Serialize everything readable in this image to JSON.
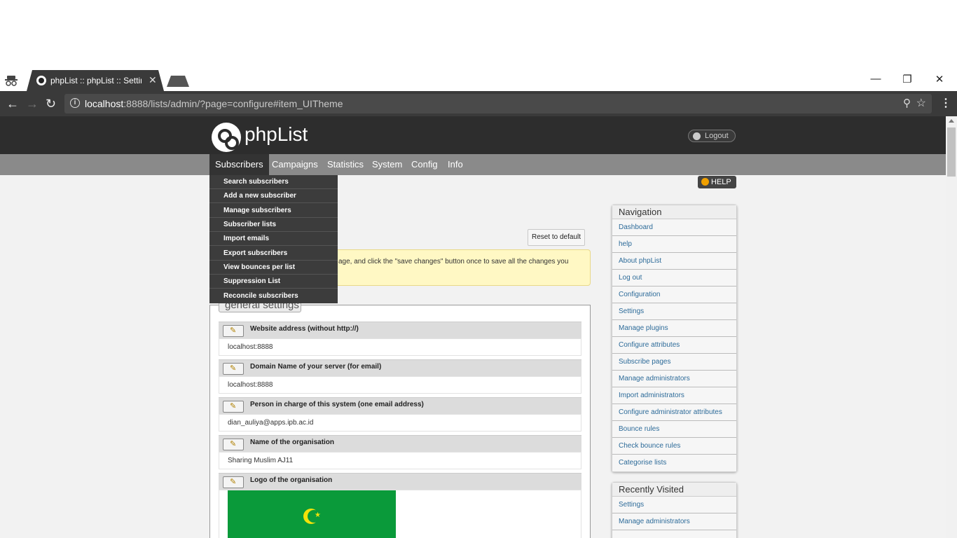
{
  "browser": {
    "tab_title": "phpList :: phpList :: Settings",
    "url_host": "localhost",
    "url_rest": ":8888/lists/admin/?page=configure#item_UITheme"
  },
  "header": {
    "brand": "phpList",
    "logout": "Logout",
    "help": "HELP"
  },
  "mainnav": [
    "Subscribers",
    "Campaigns",
    "Statistics",
    "System",
    "Config",
    "Info"
  ],
  "subscribers_menu": [
    "Search subscribers",
    "Add a new subscriber",
    "Manage subscribers",
    "Subscriber lists",
    "Import emails",
    "Export subscribers",
    "View bounces per list",
    "Suppression List",
    "Reconcile subscribers"
  ],
  "content": {
    "reset_button": "Reset to default",
    "notice_visible": "age, and click the \"save changes\" button once to save all the changes you",
    "section_legend": "general settings",
    "settings": [
      {
        "label": "Website address (without http://)",
        "value": "localhost:8888"
      },
      {
        "label": "Domain Name of your server (for email)",
        "value": "localhost:8888"
      },
      {
        "label": "Person in charge of this system (one email address)",
        "value": "dian_auliya@apps.ipb.ac.id"
      },
      {
        "label": "Name of the organisation",
        "value": "Sharing Muslim AJ11"
      },
      {
        "label": "Logo of the organisation",
        "value": ""
      }
    ]
  },
  "navigation_panel": {
    "title": "Navigation",
    "items": [
      "Dashboard",
      "help",
      "About phpList",
      "Log out",
      "Configuration",
      "Settings",
      "Manage plugins",
      "Configure attributes",
      "Subscribe pages",
      "Manage administrators",
      "Import administrators",
      "Configure administrator attributes",
      "Bounce rules",
      "Check bounce rules",
      "Categorise lists"
    ]
  },
  "recent_panel": {
    "title": "Recently Visited",
    "items": [
      "Settings",
      "Manage administrators"
    ]
  }
}
